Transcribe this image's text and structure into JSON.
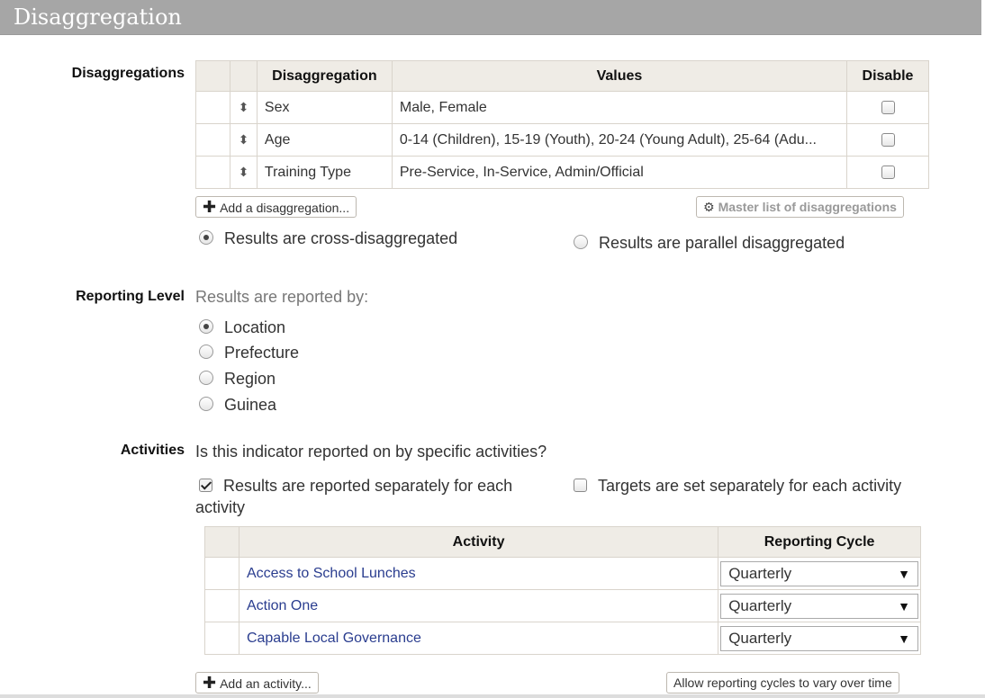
{
  "header": {
    "title": "Disaggregation"
  },
  "disaggregations": {
    "label": "Disaggregations",
    "columns": [
      "Disaggregation",
      "Values",
      "Disable"
    ],
    "rows": [
      {
        "name": "Sex",
        "values": "Male, Female"
      },
      {
        "name": "Age",
        "values": "0-14 (Children), 15-19 (Youth), 20-24 (Young Adult), 25-64 (Adu..."
      },
      {
        "name": "Training Type",
        "values": "Pre-Service, In-Service, Admin/Official"
      }
    ],
    "add_label": "Add a disaggregation...",
    "master_label": "Master list of disaggregations",
    "cross_label": "Results are cross-disaggregated",
    "parallel_label": "Results are parallel disaggregated"
  },
  "reporting": {
    "label": "Reporting Level",
    "prompt": "Results are reported by:",
    "options": [
      "Location",
      "Prefecture",
      "Region",
      "Guinea"
    ]
  },
  "activities": {
    "label": "Activities",
    "question": "Is this indicator reported on by specific activities?",
    "separate_results_label": "Results are reported separately for each",
    "separate_results_label_2": "activity",
    "separate_targets_label": "Targets are set separately for each activity",
    "columns": [
      "Activity",
      "Reporting Cycle"
    ],
    "rows": [
      {
        "name": "Access to School Lunches",
        "cycle": "Quarterly"
      },
      {
        "name": "Action One",
        "cycle": "Quarterly"
      },
      {
        "name": "Capable Local Governance",
        "cycle": "Quarterly"
      }
    ],
    "add_label": "Add an activity...",
    "vary_label": "Allow reporting cycles to vary over time"
  }
}
